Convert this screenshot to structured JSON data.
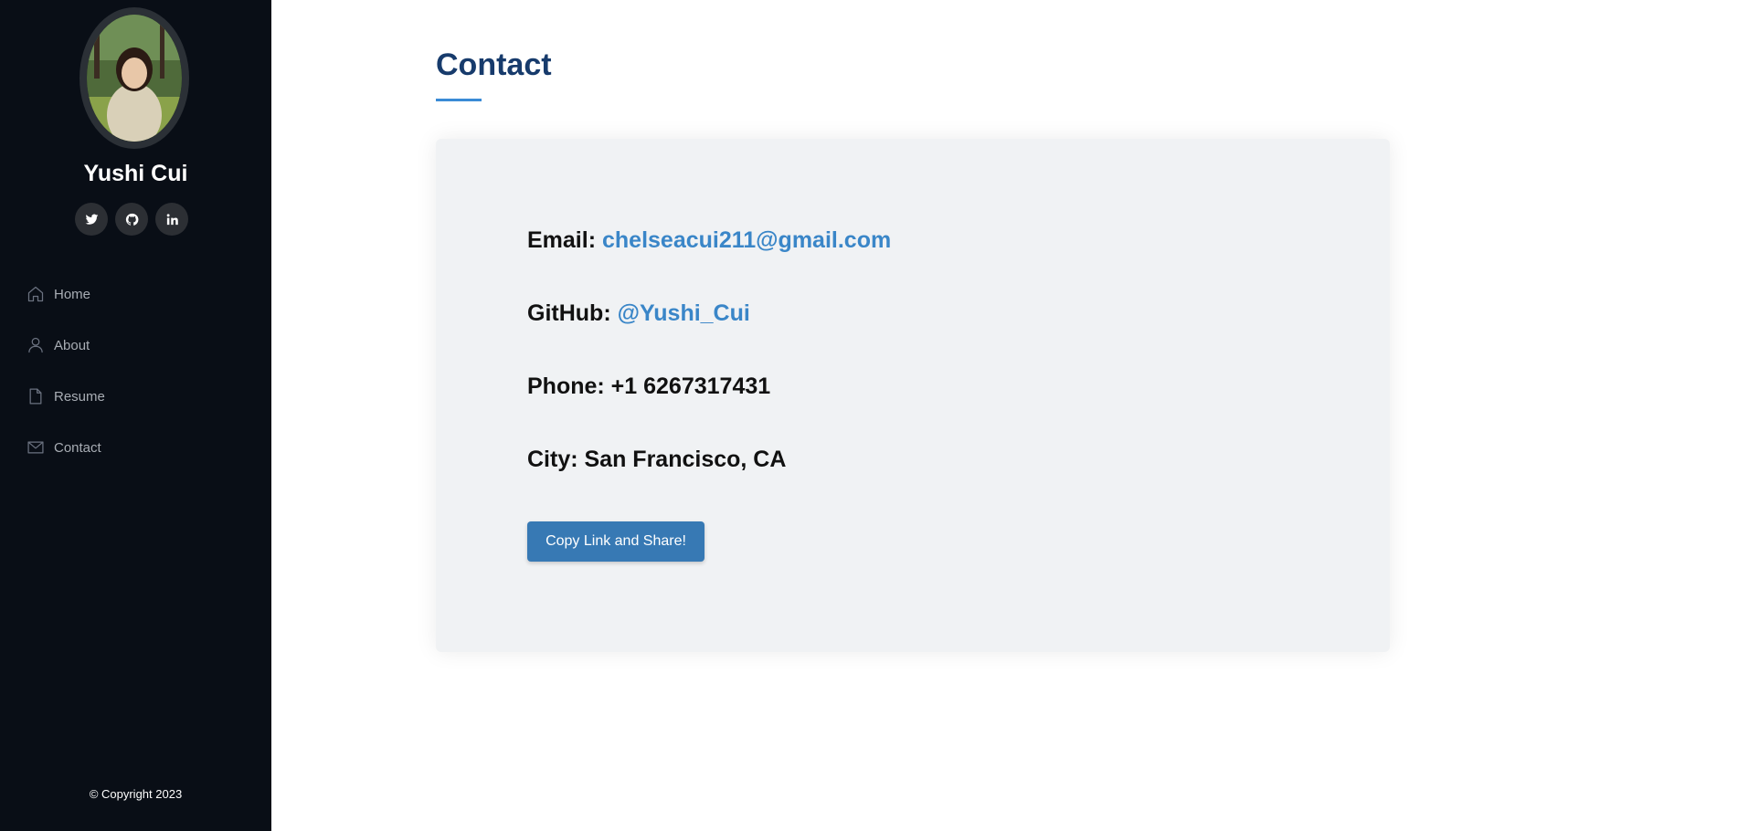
{
  "sidebar": {
    "name": "Yushi Cui",
    "socials": [
      {
        "icon": "twitter-icon"
      },
      {
        "icon": "github-icon"
      },
      {
        "icon": "linkedin-icon"
      }
    ],
    "nav": [
      {
        "label": "Home",
        "icon": "home-icon"
      },
      {
        "label": "About",
        "icon": "person-icon"
      },
      {
        "label": "Resume",
        "icon": "file-icon"
      },
      {
        "label": "Contact",
        "icon": "envelope-icon"
      }
    ],
    "copyright": "© Copyright 2023"
  },
  "main": {
    "title": "Contact",
    "contact": {
      "email_label": "Email: ",
      "email_value": "chelseacui211@gmail.com",
      "github_label": "GitHub: ",
      "github_value": "@Yushi_Cui",
      "phone_label": "Phone: ",
      "phone_value": "+1 6267317431",
      "city_label": "City: ",
      "city_value": "San Francisco, CA"
    },
    "share_button": "Copy Link and Share!"
  },
  "colors": {
    "sidebar_bg": "#090e16",
    "title": "#173b6c",
    "accent": "#3a8bd6",
    "link": "#3a86c8",
    "button": "#3779b4",
    "card_bg": "#f0f2f4"
  }
}
